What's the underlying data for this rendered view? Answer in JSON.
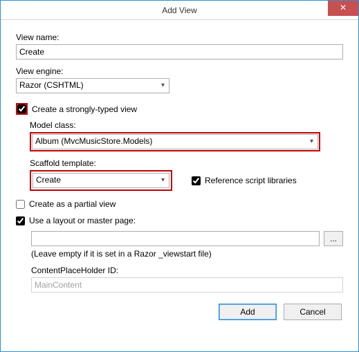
{
  "titlebar": {
    "title": "Add View",
    "close": "✕"
  },
  "viewName": {
    "label": "View name:",
    "value": "Create"
  },
  "viewEngine": {
    "label": "View engine:",
    "value": "Razor (CSHTML)"
  },
  "strongly": {
    "label": "Create a strongly-typed view"
  },
  "modelClass": {
    "label": "Model class:",
    "value": "Album (MvcMusicStore.Models)"
  },
  "scaffold": {
    "label": "Scaffold template:",
    "value": "Create"
  },
  "refScript": {
    "label": "Reference script libraries"
  },
  "partial": {
    "label": "Create as a partial view"
  },
  "layout": {
    "label": "Use a layout or master page:",
    "value": "",
    "hint": "(Leave empty if it is set in a Razor _viewstart file)",
    "placeholderLabel": "ContentPlaceHolder ID:",
    "placeholderValue": "MainContent",
    "browse": "..."
  },
  "buttons": {
    "add": "Add",
    "cancel": "Cancel"
  }
}
